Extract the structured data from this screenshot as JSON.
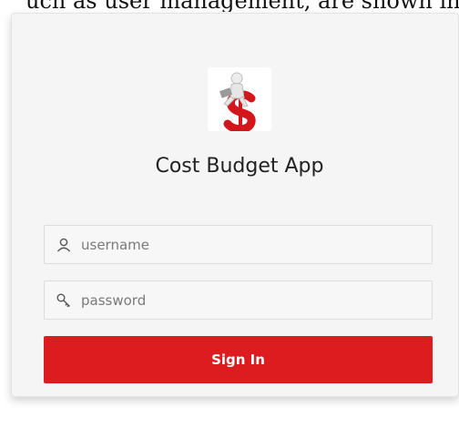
{
  "header_caption": "uch as user management, are shown in",
  "login": {
    "app_title": "Cost Budget App",
    "logo_icon": "figure-with-laptop-on-dollar-sign-logo",
    "username": {
      "icon": "user-icon",
      "placeholder": "username",
      "value": ""
    },
    "password": {
      "icon": "key-icon",
      "placeholder": "password",
      "value": ""
    },
    "signin_label": "Sign In"
  },
  "colors": {
    "accent": "#dc1c1f",
    "card_background": "#f5f5f5",
    "page_background": "#ffffff"
  }
}
